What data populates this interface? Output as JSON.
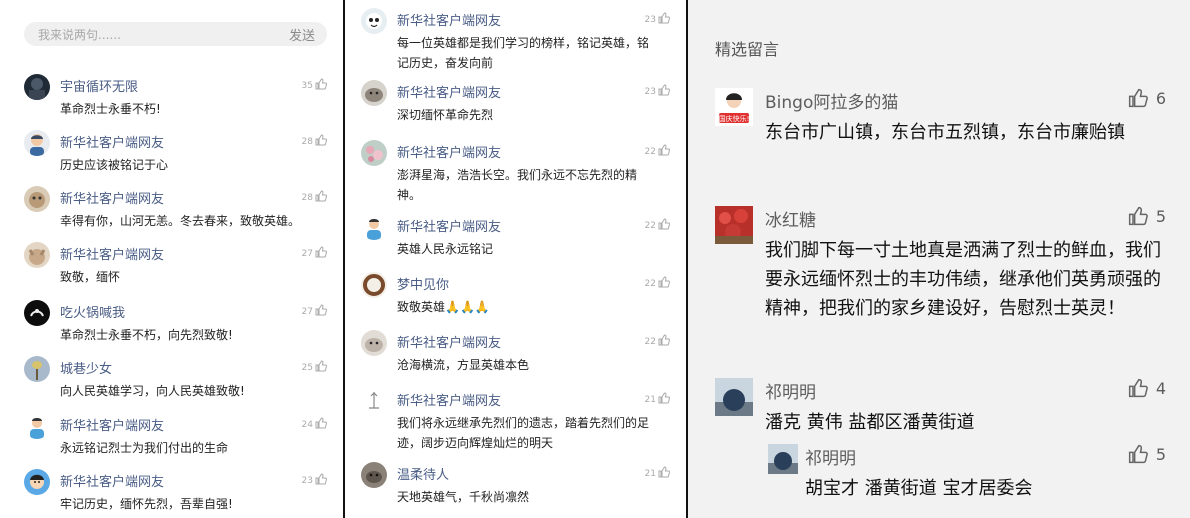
{
  "left_panel": {
    "input": {
      "placeholder": "我来说两句......",
      "send_label": "发送"
    },
    "comments": [
      {
        "name": "宇宙循环无限",
        "text": "革命烈士永垂不朽!",
        "likes": "35",
        "avatar": "dark-figure-avatar"
      },
      {
        "name": "新华社客户端网友",
        "text": "历史应该被铭记于心",
        "likes": "28",
        "avatar": "cartoon-person-avatar"
      },
      {
        "name": "新华社客户端网友",
        "text": "幸得有你，山河无恙。冬去春来，致敬英雄。",
        "likes": "28",
        "avatar": "pet-avatar"
      },
      {
        "name": "新华社客户端网友",
        "text": "致敬，缅怀",
        "likes": "27",
        "avatar": "pet-avatar"
      },
      {
        "name": "吃火锅喊我",
        "text": "革命烈士永垂不朽，向先烈致敬!",
        "likes": "27",
        "avatar": "hand-avatar"
      },
      {
        "name": "城巷少女",
        "text": "向人民英雄学习，向人民英雄致敬!",
        "likes": "25",
        "avatar": "plant-avatar"
      },
      {
        "name": "新华社客户端网友",
        "text": "永远铭记烈士为我们付出的生命",
        "likes": "24",
        "avatar": "default-person-avatar"
      },
      {
        "name": "新华社客户端网友",
        "text": "牢记历史，缅怀先烈，吾辈自强!",
        "likes": "23",
        "avatar": "cartoon-boy-avatar"
      }
    ]
  },
  "middle_panel": {
    "comments": [
      {
        "name": "新华社客户端网友",
        "text": "每一位英雄都是我们学习的榜样，铭记英雄，铭记历史，奋发向前",
        "likes": "23",
        "avatar": "cartoon-avatar"
      },
      {
        "name": "新华社客户端网友",
        "text": "深切缅怀革命先烈",
        "likes": "23",
        "avatar": "cat-avatar"
      },
      {
        "name": "新华社客户端网友",
        "text": "澎湃星海，浩浩长空。我们永远不忘先烈的精神。",
        "likes": "22",
        "avatar": "flower-avatar"
      },
      {
        "name": "新华社客户端网友",
        "text": "英雄人民永远铭记",
        "likes": "22",
        "avatar": "default-person-avatar"
      },
      {
        "name": "梦中见你",
        "text": "致敬英雄🙏🙏🙏",
        "likes": "22",
        "avatar": "ring-avatar"
      },
      {
        "name": "新华社客户端网友",
        "text": "沧海横流，方显英雄本色",
        "likes": "22",
        "avatar": "cat-avatar"
      },
      {
        "name": "新华社客户端网友",
        "text": "我们将永远继承先烈们的遗志，踏着先烈们的足迹，阔步迈向辉煌灿烂的明天",
        "likes": "21",
        "avatar": "sketch-avatar"
      },
      {
        "name": "温柔待人",
        "text": "天地英雄气，千秋尚凛然",
        "likes": "21",
        "avatar": "animal-avatar"
      }
    ]
  },
  "right_panel": {
    "section_title": "精选留言",
    "comments": [
      {
        "name": "Bingo阿拉多的猫",
        "text": "东台市广山镇，东台市五烈镇，东台市廉贻镇",
        "likes": "6",
        "avatar": "national-day-avatar",
        "avatar_text": "国庆快乐!"
      },
      {
        "name": "冰红糖",
        "text": "我们脚下每一寸土地真是洒满了烈士的鲜血，我们要永远缅怀烈士的丰功伟绩，继承他们英勇顽强的精神，把我们的家乡建设好，告慰烈士英灵！",
        "likes": "5",
        "avatar": "red-flowers-avatar"
      },
      {
        "name": "祁明明",
        "text": "潘克 黄伟 盐都区潘黄街道",
        "likes": "4",
        "avatar": "sphere-avatar"
      },
      {
        "name": "祁明明",
        "text": "胡宝才 潘黄街道 宝才居委会",
        "likes": "5",
        "avatar": "sphere-avatar",
        "is_reply": true
      }
    ]
  },
  "colors": {
    "username_blue": "#4a5d86",
    "panel_gray": "#f2f2f2",
    "like_gray": "#aaaaaa"
  }
}
